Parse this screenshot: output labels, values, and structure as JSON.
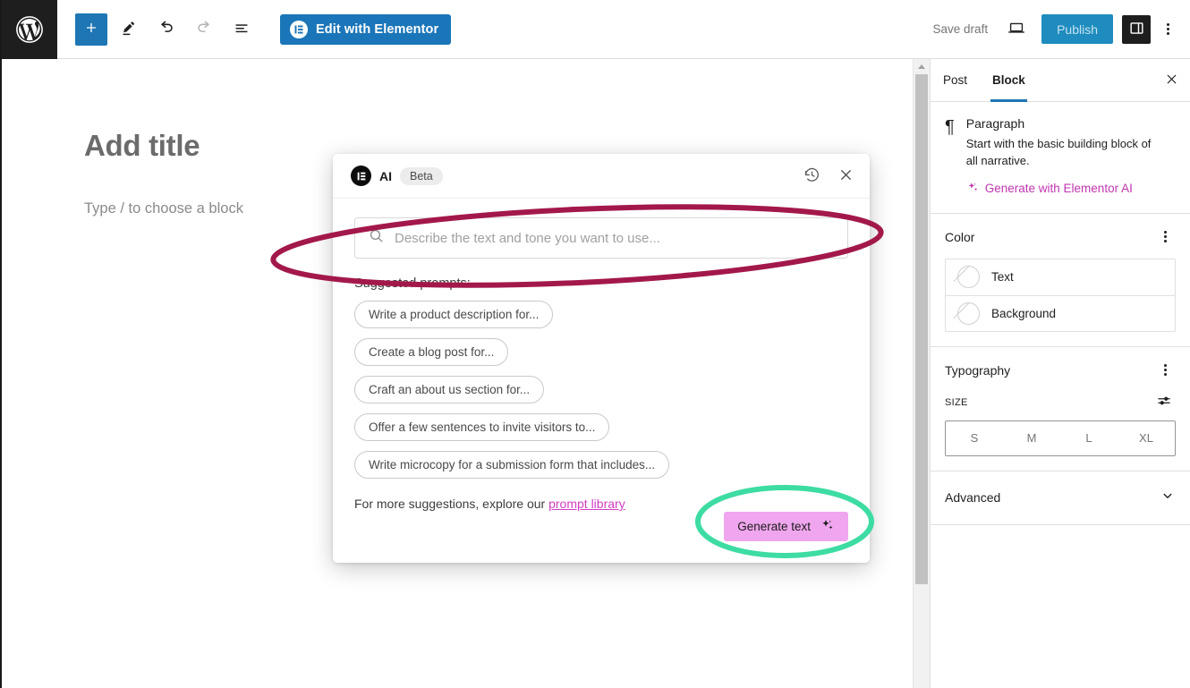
{
  "toolbar": {
    "wp_logo": "wordpress-logo",
    "add_block_label": "+",
    "edit_label": "Edit",
    "undo_label": "Undo",
    "redo_label": "Redo",
    "list_view_label": "Document overview",
    "elementor_button": "Edit with Elementor",
    "save_draft": "Save draft",
    "preview_label": "Preview",
    "publish": "Publish",
    "settings_label": "Settings",
    "options_label": "Options"
  },
  "canvas": {
    "title_placeholder": "Add title",
    "body_placeholder": "Type / to choose a block"
  },
  "sidebar": {
    "tabs": [
      {
        "label": "Post",
        "active": false
      },
      {
        "label": "Block",
        "active": true
      }
    ],
    "close_label": "Close settings",
    "block": {
      "icon": "pilcrow-icon",
      "name": "Paragraph",
      "description": "Start with the basic building block of all narrative.",
      "generate_link": "Generate with Elementor AI"
    },
    "color": {
      "title": "Color",
      "options": [
        {
          "label": "Text"
        },
        {
          "label": "Background"
        }
      ]
    },
    "typography": {
      "title": "Typography",
      "size_label": "SIZE",
      "sizes": [
        "S",
        "M",
        "L",
        "XL"
      ]
    },
    "advanced": {
      "title": "Advanced"
    }
  },
  "modal": {
    "logo": "elementor-logo",
    "title": "AI",
    "badge": "Beta",
    "history_label": "History",
    "close_label": "Close",
    "search": {
      "placeholder": "Describe the text and tone you want to use...",
      "value": ""
    },
    "suggested_label": "Suggested prompts:",
    "prompts": [
      "Write a product description for...",
      "Create a blog post for...",
      "Craft an about us section for...",
      "Offer a few sentences to invite visitors to...",
      "Write microcopy for a submission form that includes..."
    ],
    "more_prefix": "For more suggestions, explore our ",
    "more_link": "prompt library",
    "generate_button": "Generate text"
  },
  "annotations": {
    "ellipse_prompt_color": "#a3184b",
    "ellipse_generate_color": "#3ddca3"
  },
  "colors": {
    "wp_blue": "#1e76b4",
    "elementor_blue": "#1b76b9",
    "publish_blue": "#1e8cbe",
    "ai_pink": "#f0a6ee",
    "link_pink": "#d33ec4",
    "elementor_ai_purple": "#c035b0"
  }
}
